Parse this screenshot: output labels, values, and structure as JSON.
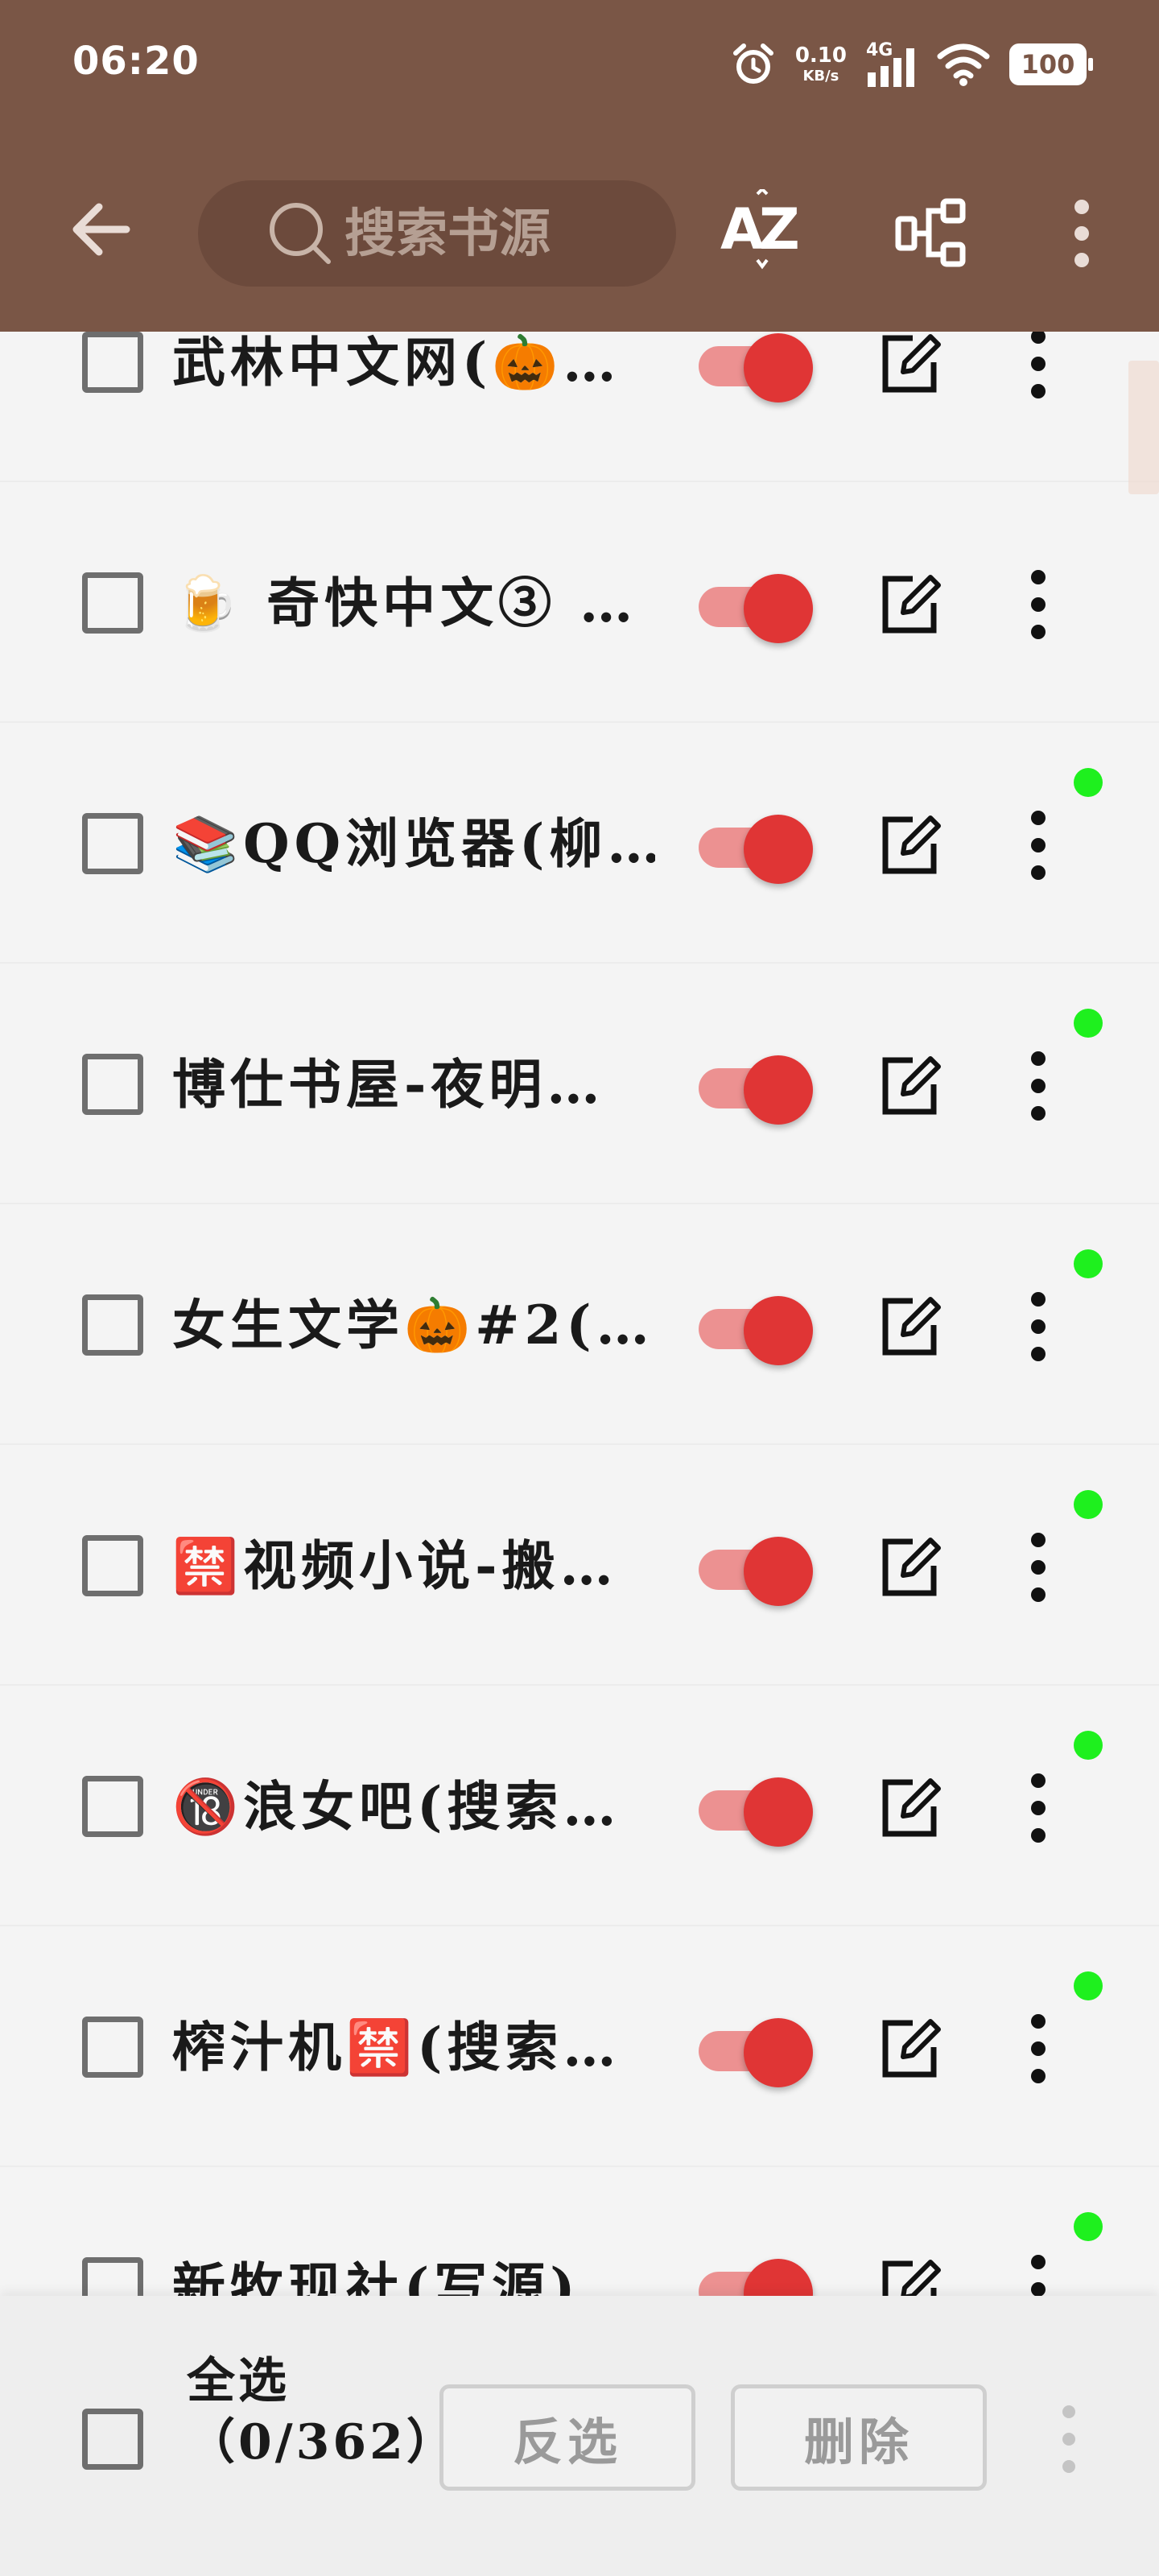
{
  "status_bar": {
    "time": "06:20",
    "net_speed_value": "0.10",
    "net_speed_unit": "KB/s",
    "network": "4G",
    "battery": "100"
  },
  "toolbar": {
    "search_placeholder": "搜索书源",
    "sort_label": "AZ"
  },
  "list": {
    "items": [
      {
        "name": "武林中文网(🎃…",
        "enabled": true,
        "online_dot": true
      },
      {
        "name": "🍺 奇快中文③ …",
        "enabled": true,
        "online_dot": false
      },
      {
        "name": "📚QQ浏览器(柳…",
        "enabled": true,
        "online_dot": true
      },
      {
        "name": "博仕书屋-夜明…",
        "enabled": true,
        "online_dot": true
      },
      {
        "name": "女生文学🎃#2(…",
        "enabled": true,
        "online_dot": true
      },
      {
        "name": "🈲视频小说-搬…",
        "enabled": true,
        "online_dot": true
      },
      {
        "name": "🔞浪女吧(搜索…",
        "enabled": true,
        "online_dot": true
      },
      {
        "name": "榨汁机🈲(搜索…",
        "enabled": true,
        "online_dot": true
      },
      {
        "name": "新牧现社(写源)",
        "enabled": true,
        "online_dot": true
      }
    ]
  },
  "bottom_bar": {
    "select_all_label": "全选（0/362）",
    "invert_label": "反选",
    "delete_label": "删除"
  },
  "colors": {
    "app_bar": "#7a5646",
    "switch_on": "#e03535",
    "online_dot": "#1ef01e"
  }
}
